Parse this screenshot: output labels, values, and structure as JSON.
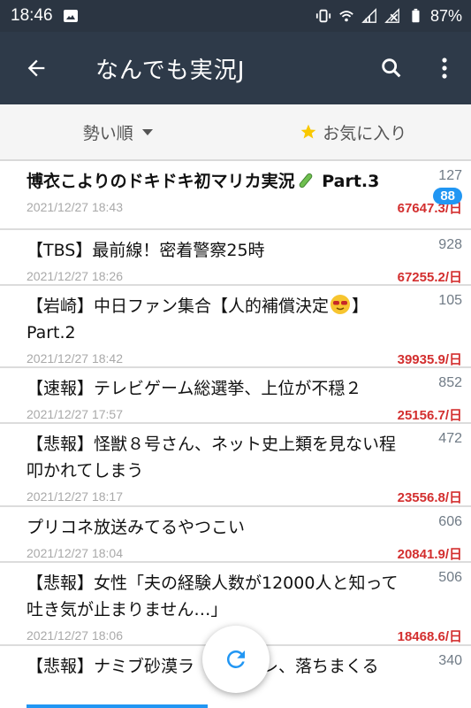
{
  "status": {
    "time": "18:46",
    "battery": "87%"
  },
  "appbar": {
    "title": "なんでも実況J"
  },
  "tabs": [
    {
      "label": "勢い順"
    },
    {
      "label": "お気に入り"
    }
  ],
  "threads": [
    {
      "title": "博衣こよりのドキドキ初マリカ実況",
      "suffix": " Part.3",
      "count": "127",
      "badge": "88",
      "date": "2021/12/27 18:43",
      "speed": "67647.3/日"
    },
    {
      "title": "【TBS】最前線！密着警察25時",
      "count": "928",
      "date": "2021/12/27 18:26",
      "speed": "67255.2/日"
    },
    {
      "title": "【岩崎】中日ファン集合【人的補償決定",
      "suffix": "】Part.2",
      "count": "105",
      "date": "2021/12/27 18:42",
      "speed": "39935.9/日"
    },
    {
      "title": "【速報】テレビゲーム総選挙、上位が不穏２",
      "count": "852",
      "date": "2021/12/27 17:57",
      "speed": "25156.7/日"
    },
    {
      "title": "【悲報】怪獣８号さん、ネット史上類を見ない程叩かれてしまう",
      "count": "472",
      "date": "2021/12/27 18:17",
      "speed": "23556.8/日"
    },
    {
      "title": "プリコネ放送みてるやつこい",
      "count": "606",
      "date": "2021/12/27 18:04",
      "speed": "20841.9/日"
    },
    {
      "title": "【悲報】女性「夫の経験人数が12000人と知って吐き気が止まりません…」",
      "count": "506",
      "date": "2021/12/27 18:06",
      "speed": "18468.6/日"
    },
    {
      "title": "【悲報】ナミブ砂漠ラ　　況スレ、落ちまくる",
      "count": "340"
    }
  ]
}
